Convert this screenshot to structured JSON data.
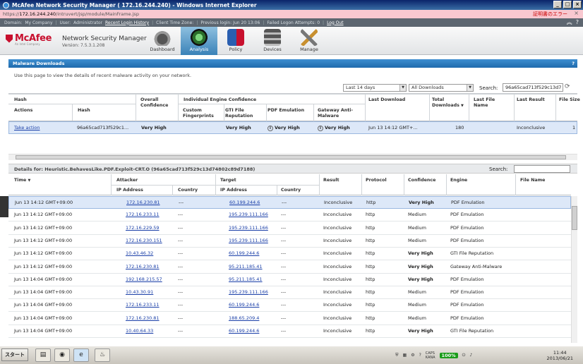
{
  "window": {
    "title": "McAfee Network Security Manager ( 172.16.244.240) - Windows Internet Explorer",
    "url_prefix": "https://",
    "url_host": "172.16.244.240",
    "url_path": "/intruvert/jsp/module/MainFrame.jsp",
    "cert_error": "証明書のエラー",
    "min": "_",
    "max": "□",
    "close": "×"
  },
  "topinfo": {
    "domain_label": "Domain:",
    "domain": "My Company",
    "user_label": "User:",
    "user": "Administrator",
    "recent_login": "Recent Login History",
    "timezone_label": "Client Time Zone:",
    "previous_login": "Previous login: Jun 20 13:06",
    "failed_attempts": "Failed Logon Attempts: 0",
    "logout": "Log Out",
    "collapse": "︽",
    "help": "?"
  },
  "header": {
    "brand": "McAfee",
    "brand_sub": "An Intel Company",
    "product": "Network Security Manager",
    "version": "Version: 7.5.3.1.208",
    "nav": [
      "Dashboard",
      "Analysis",
      "Policy",
      "Devices",
      "Manage"
    ],
    "active_nav": "Analysis"
  },
  "panel": {
    "title": "Malware Downloads",
    "help": "?",
    "description": "Use this page to view the details of recent malware activity on your network.",
    "period": "Last 14 days",
    "filter": "All Downloads",
    "search_label": "Search:",
    "search_value": "96a65cad713f529c13d7",
    "refresh": "⟳"
  },
  "downloads_table": {
    "h_hash": "Hash",
    "h_actions": "Actions",
    "h_hash2": "Hash",
    "h_overall": "Overall Confidence",
    "h_individual": "Individual Engine Confidence",
    "h_custom": "Custom Fingerprints",
    "h_gti": "GTI File Reputation",
    "h_pdf": "PDF Emulation",
    "h_gateway": "Gateway Anti-Malware",
    "h_last_download": "Last Download",
    "h_total": "Total Downloads",
    "sort_desc": "▼",
    "h_last_file": "Last File Name",
    "h_last_result": "Last Result",
    "h_file_size": "File Size",
    "row": {
      "action": "Take action",
      "hash": "96a65cad713f529c1...",
      "overall": "Very High",
      "custom": "",
      "gti": "Very High",
      "info_icon": "i",
      "pdf": "Very High",
      "gateway": "Very High",
      "last_download": "Jun 13 14:12 GMT+...",
      "total": "180",
      "last_file": "",
      "last_result": "Inconclusive",
      "file_size": "1"
    }
  },
  "details": {
    "title": "Details for: Heuristic.BehavesLike.PDF.Exploit-CRT.O (96a65cad713f529c13d74802c89d7188)",
    "search_label": "Search:",
    "h_time": "Time",
    "sort_desc": "▼",
    "h_attacker": "Attacker",
    "h_target": "Target",
    "h_ip": "IP Address",
    "h_country": "Country",
    "h_result": "Result",
    "h_protocol": "Protocol",
    "h_confidence": "Confidence",
    "h_engine": "Engine",
    "h_file_name": "File Name",
    "rows": [
      {
        "time": "Jun 13 14:12 GMT+09:00",
        "a_ip": "172.16.230.81",
        "a_country": "---",
        "t_ip": "60.199.244.6",
        "t_country": "---",
        "result": "Inconclusive",
        "protocol": "http",
        "confidence": "Very High",
        "engine": "PDF Emulation"
      },
      {
        "time": "Jun 13 14:12 GMT+09:00",
        "a_ip": "172.16.233.11",
        "a_country": "---",
        "t_ip": "195.239.111.166",
        "t_country": "---",
        "result": "Inconclusive",
        "protocol": "http",
        "confidence": "Medium",
        "engine": "PDF Emulation"
      },
      {
        "time": "Jun 13 14:12 GMT+09:00",
        "a_ip": "172.16.229.59",
        "a_country": "---",
        "t_ip": "195.239.111.166",
        "t_country": "---",
        "result": "Inconclusive",
        "protocol": "http",
        "confidence": "Medium",
        "engine": "PDF Emulation"
      },
      {
        "time": "Jun 13 14:12 GMT+09:00",
        "a_ip": "172.16.230.151",
        "a_country": "---",
        "t_ip": "195.239.111.166",
        "t_country": "---",
        "result": "Inconclusive",
        "protocol": "http",
        "confidence": "Medium",
        "engine": "PDF Emulation"
      },
      {
        "time": "Jun 13 14:12 GMT+09:00",
        "a_ip": "10.43.46.32",
        "a_country": "---",
        "t_ip": "60.199.244.6",
        "t_country": "---",
        "result": "Inconclusive",
        "protocol": "http",
        "confidence": "Very High",
        "engine": "GTI File Reputation"
      },
      {
        "time": "Jun 13 14:12 GMT+09:00",
        "a_ip": "172.16.230.81",
        "a_country": "---",
        "t_ip": "95.211.185.41",
        "t_country": "---",
        "result": "Inconclusive",
        "protocol": "http",
        "confidence": "Very High",
        "engine": "Gateway Anti-Malware"
      },
      {
        "time": "Jun 13 14:04 GMT+09:00",
        "a_ip": "192.168.215.57",
        "a_country": "---",
        "t_ip": "95.211.185.41",
        "t_country": "---",
        "result": "Inconclusive",
        "protocol": "http",
        "confidence": "Very High",
        "engine": "PDF Emulation"
      },
      {
        "time": "Jun 13 14:04 GMT+09:00",
        "a_ip": "10.43.30.91",
        "a_country": "---",
        "t_ip": "195.239.111.166",
        "t_country": "---",
        "result": "Inconclusive",
        "protocol": "http",
        "confidence": "Medium",
        "engine": "PDF Emulation"
      },
      {
        "time": "Jun 13 14:04 GMT+09:00",
        "a_ip": "172.16.233.11",
        "a_country": "---",
        "t_ip": "60.199.244.6",
        "t_country": "---",
        "result": "Inconclusive",
        "protocol": "http",
        "confidence": "Medium",
        "engine": "PDF Emulation"
      },
      {
        "time": "Jun 13 14:04 GMT+09:00",
        "a_ip": "172.16.230.81",
        "a_country": "---",
        "t_ip": "188.65.209.4",
        "t_country": "---",
        "result": "Inconclusive",
        "protocol": "http",
        "confidence": "Medium",
        "engine": "PDF Emulation"
      },
      {
        "time": "Jun 13 14:04 GMT+09:00",
        "a_ip": "10.40.64.33",
        "a_country": "---",
        "t_ip": "60.199.244.6",
        "t_country": "---",
        "result": "Inconclusive",
        "protocol": "http",
        "confidence": "Very High",
        "engine": "GTI File Reputation"
      }
    ]
  },
  "taskbar": {
    "start": "スタート",
    "battery": "100%",
    "caps": "CAPS",
    "kana": "KANA",
    "time": "11:44",
    "date": "2013/06/21"
  },
  "colors": {
    "accent": "#1f6aad",
    "brand": "#c8102e",
    "link": "#1a3fa8",
    "selected_row": "#dde8f8"
  }
}
